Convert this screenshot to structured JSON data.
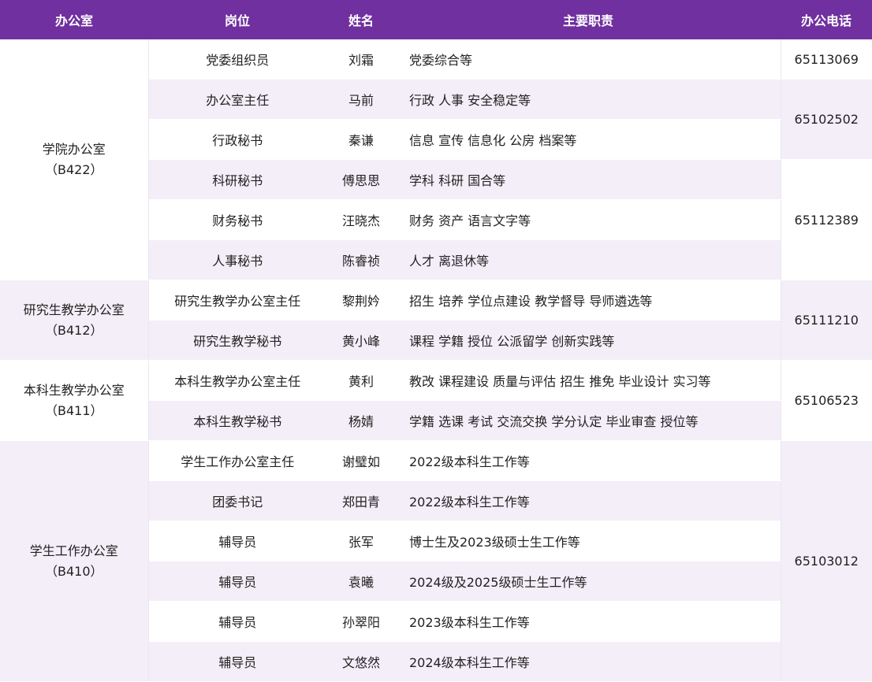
{
  "headers": {
    "office": "办公室",
    "position": "岗位",
    "name": "姓名",
    "duty": "主要职责",
    "phone": "办公电话"
  },
  "offices": [
    {
      "name": "学院办公室",
      "room": "（B422）"
    },
    {
      "name": "研究生教学办公室",
      "room": "（B412）"
    },
    {
      "name": "本科生教学办公室",
      "room": "（B411）"
    },
    {
      "name": "学生工作办公室",
      "room": "（B410）"
    }
  ],
  "phones": [
    "65113069",
    "65102502",
    "65112389",
    "65111210",
    "65106523",
    "65103012"
  ],
  "rows": [
    {
      "position": "党委组织员",
      "name": "刘霜",
      "duty": "党委综合等"
    },
    {
      "position": "办公室主任",
      "name": "马前",
      "duty": "行政 人事 安全稳定等"
    },
    {
      "position": "行政秘书",
      "name": "秦谦",
      "duty": "信息 宣传 信息化 公房 档案等"
    },
    {
      "position": "科研秘书",
      "name": "傅思思",
      "duty": "学科 科研 国合等"
    },
    {
      "position": "财务秘书",
      "name": "汪晓杰",
      "duty": "财务 资产 语言文字等"
    },
    {
      "position": "人事秘书",
      "name": "陈睿祯",
      "duty": "人才 离退休等"
    },
    {
      "position": "研究生教学办公室主任",
      "name": "黎荆妗",
      "duty": "招生 培养 学位点建设 教学督导 导师遴选等"
    },
    {
      "position": "研究生教学秘书",
      "name": "黄小峰",
      "duty": "课程 学籍 授位 公派留学 创新实践等"
    },
    {
      "position": "本科生教学办公室主任",
      "name": "黄利",
      "duty": "教改 课程建设 质量与评估 招生 推免 毕业设计 实习等"
    },
    {
      "position": "本科生教学秘书",
      "name": "杨婧",
      "duty": "学籍 选课 考试 交流交换 学分认定 毕业审查 授位等"
    },
    {
      "position": "学生工作办公室主任",
      "name": "谢璧如",
      "duty": "2022级本科生工作等"
    },
    {
      "position": "团委书记",
      "name": "郑田青",
      "duty": "2022级本科生工作等"
    },
    {
      "position": "辅导员",
      "name": "张军",
      "duty": "博士生及2023级硕士生工作等"
    },
    {
      "position": "辅导员",
      "name": "袁曦",
      "duty": "2024级及2025级硕士生工作等"
    },
    {
      "position": "辅导员",
      "name": "孙翠阳",
      "duty": "2023级本科生工作等"
    },
    {
      "position": "辅导员",
      "name": "文悠然",
      "duty": "2024级本科生工作等"
    }
  ]
}
